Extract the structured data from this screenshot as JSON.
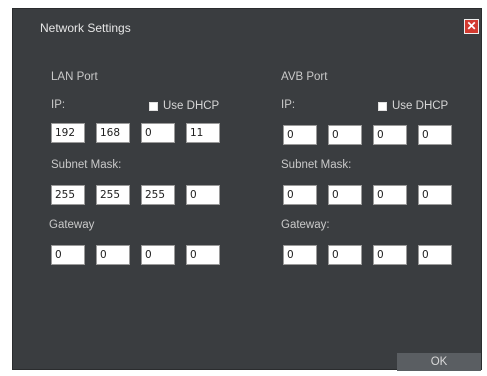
{
  "window": {
    "title": "Network Settings",
    "close_glyph": "✕"
  },
  "lan": {
    "header": "LAN Port",
    "ip_label": "IP:",
    "dhcp_label": "Use DHCP",
    "ip": [
      "192",
      "168",
      "0",
      "11"
    ],
    "subnet_label": "Subnet Mask:",
    "subnet": [
      "255",
      "255",
      "255",
      "0"
    ],
    "gateway_label": "Gateway",
    "gateway": [
      "0",
      "0",
      "0",
      "0"
    ]
  },
  "avb": {
    "header": "AVB Port",
    "ip_label": "IP:",
    "dhcp_label": "Use DHCP",
    "ip": [
      "0",
      "0",
      "0",
      "0"
    ],
    "subnet_label": "Subnet Mask:",
    "subnet": [
      "0",
      "0",
      "0",
      "0"
    ],
    "gateway_label": "Gateway:",
    "gateway": [
      "0",
      "0",
      "0",
      "0"
    ]
  },
  "footer": {
    "ok_label": "OK"
  },
  "colors": {
    "dialog_bg": "#3a3d40",
    "close_red": "#d23a30",
    "ok_bg": "#5a5e62"
  }
}
